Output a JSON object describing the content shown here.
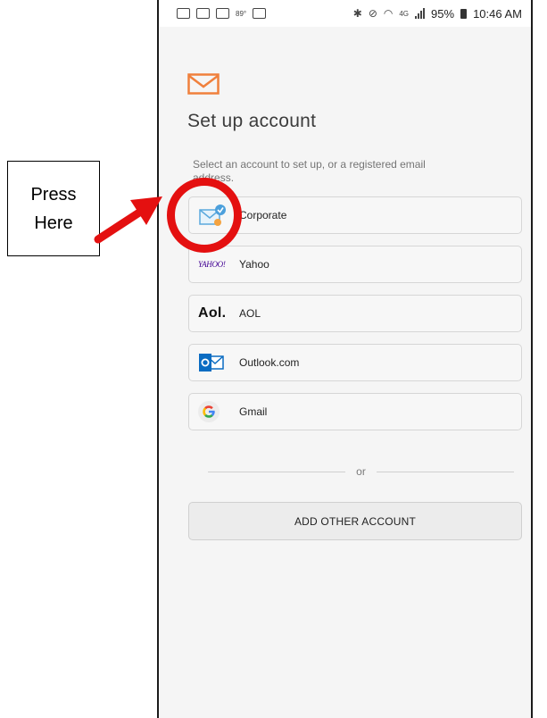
{
  "status_bar": {
    "temperature": "89°",
    "signal_label": "4G",
    "battery": "95%",
    "time": "10:46 AM"
  },
  "header": {
    "title": "Set up account",
    "subtitle": "Select an account to set up, or a registered email address."
  },
  "accounts": [
    {
      "label": "Corporate",
      "icon": "corporate-mail-icon"
    },
    {
      "label": "Yahoo",
      "icon": "yahoo-logo",
      "logo_text": "YAHOO!"
    },
    {
      "label": "AOL",
      "icon": "aol-logo",
      "logo_text": "Aol."
    },
    {
      "label": "Outlook.com",
      "icon": "outlook-icon"
    },
    {
      "label": "Gmail",
      "icon": "google-icon"
    }
  ],
  "divider_text": "or",
  "add_other_label": "ADD OTHER ACCOUNT",
  "annotation": {
    "callout_line1": "Press",
    "callout_line2": "Here",
    "arrow_color": "#e41010",
    "circle_color": "#e41010"
  },
  "colors": {
    "mail_accent": "#f0803c",
    "outlook_blue": "#0a6cc2",
    "yahoo_purple": "#410093"
  }
}
